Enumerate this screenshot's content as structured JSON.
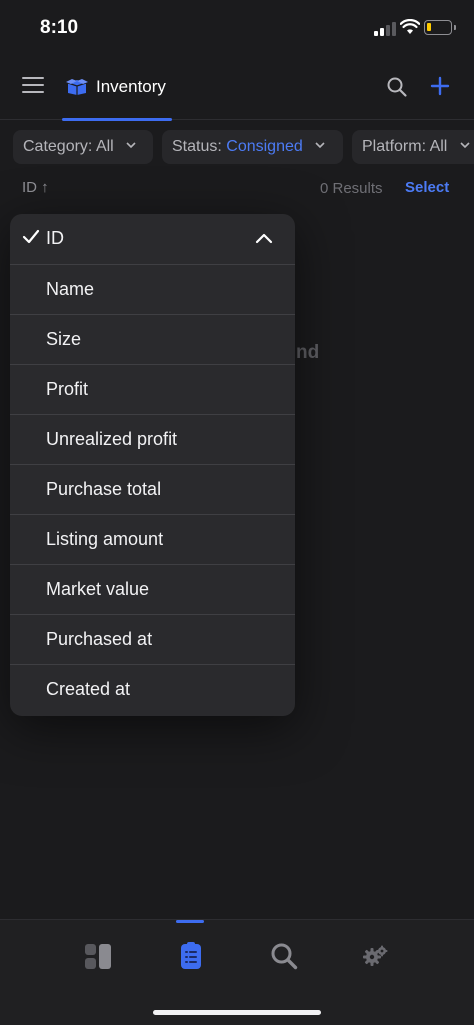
{
  "status_bar": {
    "time": "8:10"
  },
  "top_bar": {
    "tab_label": "Inventory",
    "accent_color": "#3d6cf0"
  },
  "filters": [
    {
      "key": "Category:",
      "value": "All",
      "accent": false
    },
    {
      "key": "Status:",
      "value": "Consigned",
      "accent": true
    },
    {
      "key": "Platform:",
      "value": "All",
      "accent": false
    }
  ],
  "sort": {
    "key": "ID",
    "direction_icon": "↑",
    "results": "0 Results",
    "select_label": "Select"
  },
  "background": {
    "empty_fragment": "nd"
  },
  "sort_menu": {
    "selected": "ID",
    "options": [
      "ID",
      "Name",
      "Size",
      "Profit",
      "Unrealized profit",
      "Purchase total",
      "Listing amount",
      "Market value",
      "Purchased at",
      "Created at"
    ]
  },
  "tab_bar": {
    "items": [
      "dashboard-icon",
      "inventory-icon",
      "search-icon",
      "settings-icon"
    ],
    "active": "inventory-icon"
  }
}
